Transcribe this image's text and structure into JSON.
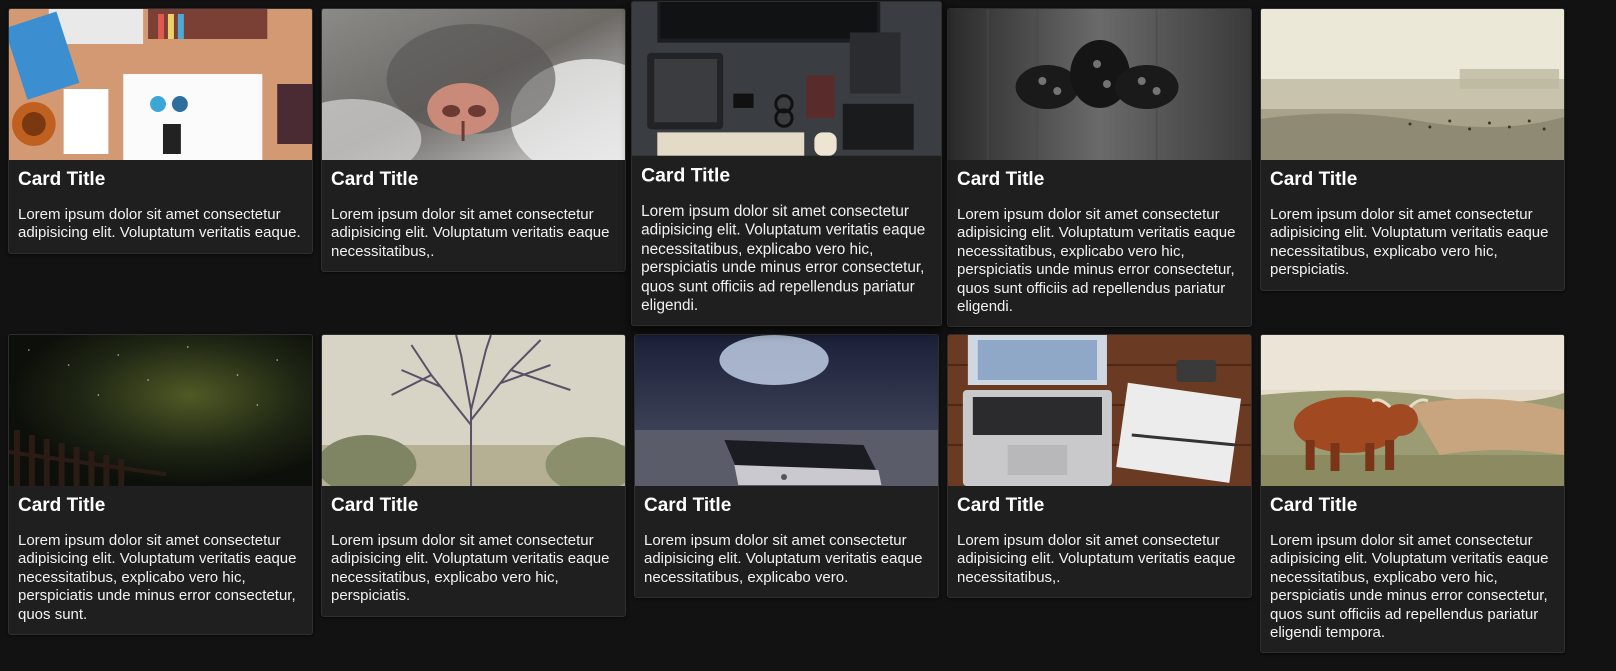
{
  "cards": [
    {
      "title": "Card Title",
      "image": "desk-workspace-photo",
      "text": "Lorem ipsum dolor sit amet consectetur adipisicing elit. Voluptatum veritatis eaque."
    },
    {
      "title": "Card Title",
      "image": "cat-nose-photo",
      "text": "Lorem ipsum dolor sit amet consectetur adipisicing elit. Voluptatum veritatis eaque necessitatibus,."
    },
    {
      "title": "Card Title",
      "image": "tablet-keyboard-flatlay-photo",
      "text": "Lorem ipsum dolor sit amet consectetur adipisicing elit. Voluptatum veritatis eaque necessitatibus, explicabo vero hic, perspiciatis unde minus error consectetur, quos sunt officiis ad repellendus pariatur eligendi."
    },
    {
      "title": "Card Title",
      "image": "pine-cones-photo",
      "text": "Lorem ipsum dolor sit amet consectetur adipisicing elit. Voluptatum veritatis eaque necessitatibus, explicabo vero hic, perspiciatis unde minus error consectetur, quos sunt officiis ad repellendus pariatur eligendi."
    },
    {
      "title": "Card Title",
      "image": "beach-photo",
      "text": "Lorem ipsum dolor sit amet consectetur adipisicing elit. Voluptatum veritatis eaque necessitatibus, explicabo vero hic, perspiciatis."
    },
    {
      "title": "Card Title",
      "image": "night-sky-photo",
      "text": "Lorem ipsum dolor sit amet consectetur adipisicing elit. Voluptatum veritatis eaque necessitatibus, explicabo vero hic, perspiciatis unde minus error consectetur, quos sunt."
    },
    {
      "title": "Card Title",
      "image": "bare-tree-photo",
      "text": "Lorem ipsum dolor sit amet consectetur adipisicing elit. Voluptatum veritatis eaque necessitatibus, explicabo vero hic, perspiciatis."
    },
    {
      "title": "Card Title",
      "image": "smartphone-photo",
      "text": "Lorem ipsum dolor sit amet consectetur adipisicing elit. Voluptatum veritatis eaque necessitatibus, explicabo vero."
    },
    {
      "title": "Card Title",
      "image": "laptop-notebook-photo",
      "text": "Lorem ipsum dolor sit amet consectetur adipisicing elit. Voluptatum veritatis eaque necessitatibus,."
    },
    {
      "title": "Card Title",
      "image": "highland-cow-photo",
      "text": "Lorem ipsum dolor sit amet consectetur adipisicing elit. Voluptatum veritatis eaque necessitatibus, explicabo vero hic, perspiciatis unde minus error consectetur, quos sunt officiis ad repellendus pariatur eligendi tempora."
    }
  ]
}
